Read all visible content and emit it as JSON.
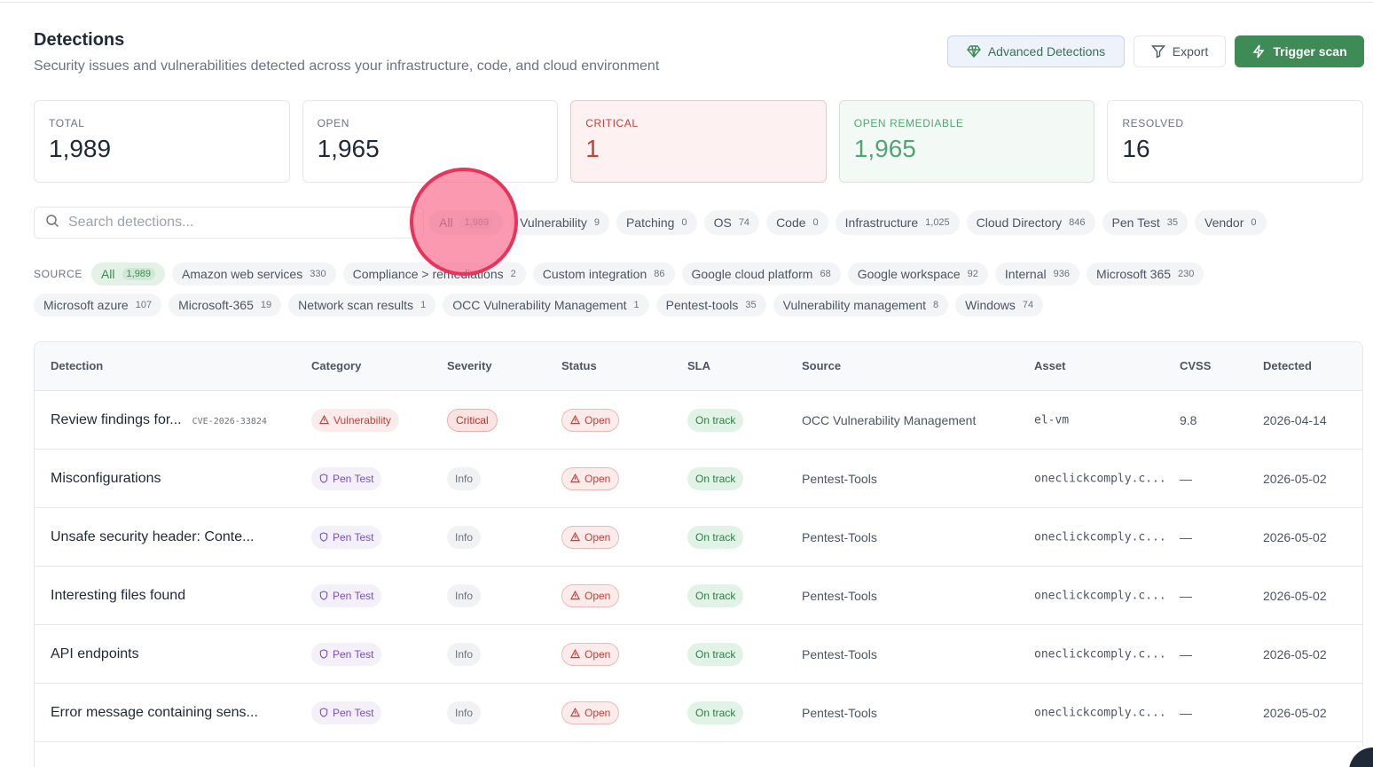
{
  "header": {
    "title": "Detections",
    "subtitle": "Security issues and vulnerabilities detected across your infrastructure, code, and cloud environment",
    "advanced_label": "Advanced Detections",
    "export_label": "Export",
    "trigger_label": "Trigger scan"
  },
  "stats": {
    "total": {
      "label": "TOTAL",
      "value": "1,989"
    },
    "open": {
      "label": "OPEN",
      "value": "1,965"
    },
    "critical": {
      "label": "CRITICAL",
      "value": "1"
    },
    "open_remediable": {
      "label": "OPEN REMEDIABLE",
      "value": "1,965"
    },
    "resolved": {
      "label": "RESOLVED",
      "value": "16"
    }
  },
  "search": {
    "placeholder": "Search detections..."
  },
  "category_filters": [
    {
      "label": "All",
      "count": "1,989"
    },
    {
      "label": "Vulnerability",
      "count": "9"
    },
    {
      "label": "Patching",
      "count": "0"
    },
    {
      "label": "OS",
      "count": "74"
    },
    {
      "label": "Code",
      "count": "0"
    },
    {
      "label": "Infrastructure",
      "count": "1,025"
    },
    {
      "label": "Cloud Directory",
      "count": "846"
    },
    {
      "label": "Pen Test",
      "count": "35"
    },
    {
      "label": "Vendor",
      "count": "0"
    }
  ],
  "source": {
    "label": "SOURCE",
    "items": [
      {
        "label": "All",
        "count": "1,989"
      },
      {
        "label": "Amazon web services",
        "count": "330"
      },
      {
        "label": "Compliance > remediations",
        "count": "2"
      },
      {
        "label": "Custom integration",
        "count": "86"
      },
      {
        "label": "Google cloud platform",
        "count": "68"
      },
      {
        "label": "Google workspace",
        "count": "92"
      },
      {
        "label": "Internal",
        "count": "936"
      },
      {
        "label": "Microsoft 365",
        "count": "230"
      },
      {
        "label": "Microsoft azure",
        "count": "107"
      },
      {
        "label": "Microsoft-365",
        "count": "19"
      },
      {
        "label": "Network scan results",
        "count": "1"
      },
      {
        "label": "OCC Vulnerability Management",
        "count": "1"
      },
      {
        "label": "Pentest-tools",
        "count": "35"
      },
      {
        "label": "Vulnerability management",
        "count": "8"
      },
      {
        "label": "Windows",
        "count": "74"
      }
    ]
  },
  "table": {
    "columns": [
      "Detection",
      "Category",
      "Severity",
      "Status",
      "SLA",
      "Source",
      "Asset",
      "CVSS",
      "Detected"
    ],
    "rows": [
      {
        "title": "Review findings for...",
        "cve": "CVE-2026-33824",
        "category": "Vulnerability",
        "severity": "Critical",
        "status": "Open",
        "sla": "On track",
        "source": "OCC Vulnerability Management",
        "asset": "el-vm",
        "cvss": "9.8",
        "detected": "2026-04-14"
      },
      {
        "title": "Misconfigurations",
        "cve": "",
        "category": "Pen Test",
        "severity": "Info",
        "status": "Open",
        "sla": "On track",
        "source": "Pentest-Tools",
        "asset": "oneclickcomply.c...",
        "cvss": "—",
        "detected": "2026-05-02"
      },
      {
        "title": "Unsafe security header: Conte...",
        "cve": "",
        "category": "Pen Test",
        "severity": "Info",
        "status": "Open",
        "sla": "On track",
        "source": "Pentest-Tools",
        "asset": "oneclickcomply.c...",
        "cvss": "—",
        "detected": "2026-05-02"
      },
      {
        "title": "Interesting files found",
        "cve": "",
        "category": "Pen Test",
        "severity": "Info",
        "status": "Open",
        "sla": "On track",
        "source": "Pentest-Tools",
        "asset": "oneclickcomply.c...",
        "cvss": "—",
        "detected": "2026-05-02"
      },
      {
        "title": "API endpoints",
        "cve": "",
        "category": "Pen Test",
        "severity": "Info",
        "status": "Open",
        "sla": "On track",
        "source": "Pentest-Tools",
        "asset": "oneclickcomply.c...",
        "cvss": "—",
        "detected": "2026-05-02"
      },
      {
        "title": "Error message containing sens...",
        "cve": "",
        "category": "Pen Test",
        "severity": "Info",
        "status": "Open",
        "sla": "On track",
        "source": "Pentest-Tools",
        "asset": "oneclickcomply.c...",
        "cvss": "—",
        "detected": "2026-05-02"
      }
    ]
  },
  "colors": {
    "accent": "#3f8b55",
    "critical": "#c2413b",
    "remediable": "#4fa673"
  }
}
